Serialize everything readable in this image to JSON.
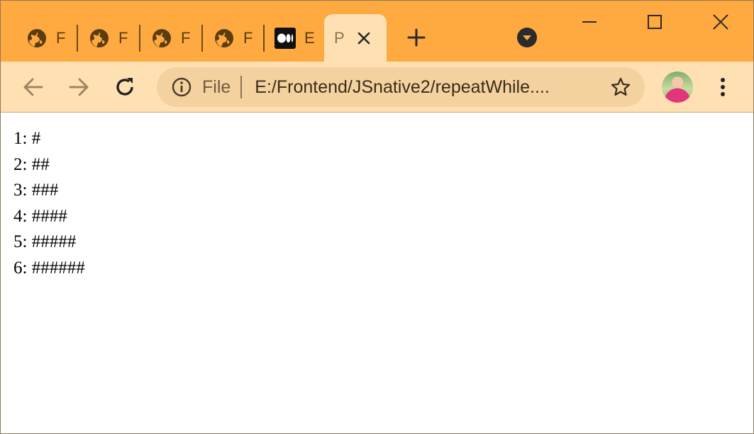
{
  "browser": {
    "tabs": [
      {
        "title": "F",
        "icon": "globe-icon"
      },
      {
        "title": "F",
        "icon": "globe-icon"
      },
      {
        "title": "F",
        "icon": "globe-icon"
      },
      {
        "title": "F",
        "icon": "globe-icon"
      },
      {
        "title": "E",
        "icon": "medium-icon"
      }
    ],
    "active_tab": {
      "title": "Pi",
      "close_icon": "close-icon"
    },
    "new_tab_icon": "plus-icon",
    "tab_search_icon": "chevron-down-icon",
    "window_controls": [
      "minimize-icon",
      "maximize-icon",
      "close-icon"
    ],
    "toolbar": {
      "back_icon": "arrow-left-icon",
      "forward_icon": "arrow-right-icon",
      "reload_icon": "reload-icon",
      "scheme": "File",
      "url": "E:/Frontend/JSnative2/repeatWhile....",
      "bookmark_icon": "star-icon",
      "menu_icon": "kebab-menu-icon"
    },
    "colors": {
      "tabstrip": "#ffa941",
      "toolbar": "#ffe0b3",
      "omnibox": "#f3d2a0"
    }
  },
  "page": {
    "lines": [
      "1: #",
      "2: ##",
      "3: ###",
      "4: ####",
      "5: #####",
      "6: ######"
    ]
  }
}
